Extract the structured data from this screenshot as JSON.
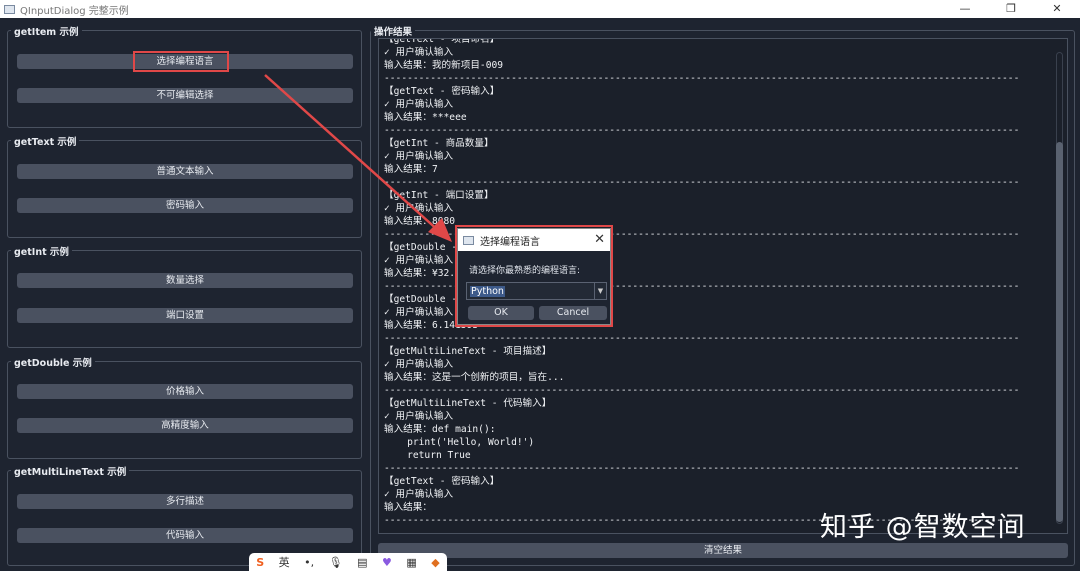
{
  "window": {
    "title": "QInputDialog 完整示例"
  },
  "groups": [
    {
      "title": "getItem 示例",
      "buttons": [
        "选择编程语言",
        "不可编辑选择"
      ]
    },
    {
      "title": "getText 示例",
      "buttons": [
        "普通文本输入",
        "密码输入"
      ]
    },
    {
      "title": "getInt 示例",
      "buttons": [
        "数量选择",
        "端口设置"
      ]
    },
    {
      "title": "getDouble 示例",
      "buttons": [
        "价格输入",
        "高精度输入"
      ]
    },
    {
      "title": "getMultiLineText 示例",
      "buttons": [
        "多行描述",
        "代码输入"
      ]
    }
  ],
  "results": {
    "title": "操作结果",
    "log": "【getText - 项目命名】\n✓ 用户确认输入\n输入结果：我的新项目-009\n--------------------------------------------------------------------------------------------------------------\n【getText - 密码输入】\n✓ 用户确认输入\n输入结果：***eee\n--------------------------------------------------------------------------------------------------------------\n【getInt - 商品数量】\n✓ 用户确认输入\n输入结果：7\n--------------------------------------------------------------------------------------------------------------\n【getInt - 端口设置】\n✓ 用户确认输入\n输入结果：8080\n--------------------------------------------------------------------------------------------------------------\n【getDouble -\n✓ 用户确认输入\n输入结果：¥32.\n--------------------------------------------------------------------------------------------------------------\n【getDouble -\n✓ 用户确认输入\n输入结果：6.141593\n--------------------------------------------------------------------------------------------------------------\n【getMultiLineText - 项目描述】\n✓ 用户确认输入\n输入结果：这是一个创新的项目，旨在...\n--------------------------------------------------------------------------------------------------------------\n【getMultiLineText - 代码输入】\n✓ 用户确认输入\n输入结果：def main():\n    print('Hello, World!')\n    return True\n--------------------------------------------------------------------------------------------------------------\n【getText - 密码输入】\n✓ 用户确认输入\n输入结果：\n--------------------------------------------------------------------------------------------------------------",
    "clear_label": "清空结果"
  },
  "dialog": {
    "title": "选择编程语言",
    "label": "请选择你最熟悉的编程语言:",
    "selected": "Python",
    "ok": "OK",
    "cancel": "Cancel"
  },
  "ime": {
    "lang": "英"
  },
  "watermark": "知乎 @智数空间",
  "colors": {
    "highlight": "#e04848",
    "background": "#1e2430",
    "button": "#4a5160"
  }
}
